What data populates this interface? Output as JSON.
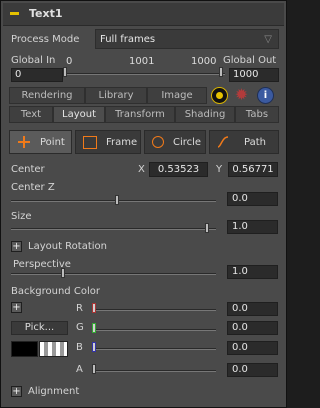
{
  "tool": {
    "title": "Text1"
  },
  "process_mode": {
    "label": "Process Mode",
    "value": "Full frames"
  },
  "global": {
    "in_label": "Global In",
    "out_label": "Global Out",
    "range_left": "0",
    "range_mid": "1001",
    "range_right": "1000",
    "in_value": "0",
    "out_value": "1000"
  },
  "tabs_top": {
    "rendering": "Rendering",
    "library": "Library",
    "image": "Image"
  },
  "tabs_main": {
    "text": "Text",
    "layout": "Layout",
    "transform": "Transform",
    "shading": "Shading",
    "tabs": "Tabs"
  },
  "layout_types": {
    "point": "Point",
    "frame": "Frame",
    "circle": "Circle",
    "path": "Path"
  },
  "center": {
    "label": "Center",
    "x_label": "X",
    "x_value": "0.53523",
    "y_label": "Y",
    "y_value": "0.56771"
  },
  "center_z": {
    "label": "Center Z",
    "value": "0.0"
  },
  "size": {
    "label": "Size",
    "value": "1.0"
  },
  "layout_rotation": {
    "label": "Layout Rotation"
  },
  "perspective": {
    "label": "Perspective",
    "value": "1.0"
  },
  "background_color": {
    "label": "Background Color",
    "pick_label": "Pick...",
    "r_label": "R",
    "g_label": "G",
    "b_label": "B",
    "a_label": "A",
    "r_value": "0.0",
    "g_value": "0.0",
    "b_value": "0.0",
    "a_value": "0.0"
  },
  "alignment": {
    "label": "Alignment"
  },
  "colors": {
    "accent": "#e5c100",
    "bg": "#4a4a4a",
    "header": "#3b3b3b"
  }
}
